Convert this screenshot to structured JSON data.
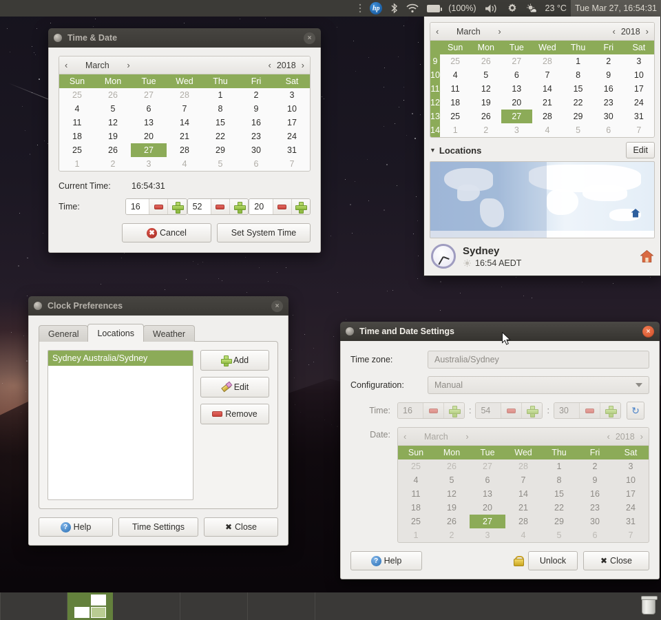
{
  "top_panel": {
    "hp_logo": "hp",
    "icons": [
      "dots-icon",
      "hp-logo-icon",
      "bluetooth-icon",
      "wifi-icon",
      "battery-icon",
      "volume-icon",
      "gear-icon",
      "weather-icon"
    ],
    "bluetooth_glyph": "✶",
    "battery_percent": "(100%)",
    "volume_glyph": "◂))",
    "gear_glyph": "⚙",
    "weather_glyph": "☀",
    "temperature": "23 °C",
    "clock": "Tue Mar 27, 16:54:31"
  },
  "time_date_dialog": {
    "title": "Time & Date",
    "close_glyph": "×",
    "calendar": {
      "prev_month_glyph": "‹",
      "month": "March",
      "next_month_glyph": "›",
      "prev_year_glyph": "‹",
      "year": "2018",
      "next_year_glyph": "›",
      "weekdays": [
        "Sun",
        "Mon",
        "Tue",
        "Wed",
        "Thu",
        "Fri",
        "Sat"
      ],
      "weeks": [
        [
          {
            "d": "25",
            "s": "dim"
          },
          {
            "d": "26",
            "s": "dim"
          },
          {
            "d": "27",
            "s": "dim"
          },
          {
            "d": "28",
            "s": "dim"
          },
          {
            "d": "1",
            "s": ""
          },
          {
            "d": "2",
            "s": ""
          },
          {
            "d": "3",
            "s": ""
          }
        ],
        [
          {
            "d": "4",
            "s": ""
          },
          {
            "d": "5",
            "s": ""
          },
          {
            "d": "6",
            "s": ""
          },
          {
            "d": "7",
            "s": ""
          },
          {
            "d": "8",
            "s": ""
          },
          {
            "d": "9",
            "s": ""
          },
          {
            "d": "10",
            "s": ""
          }
        ],
        [
          {
            "d": "11",
            "s": ""
          },
          {
            "d": "12",
            "s": ""
          },
          {
            "d": "13",
            "s": ""
          },
          {
            "d": "14",
            "s": ""
          },
          {
            "d": "15",
            "s": ""
          },
          {
            "d": "16",
            "s": ""
          },
          {
            "d": "17",
            "s": ""
          }
        ],
        [
          {
            "d": "18",
            "s": ""
          },
          {
            "d": "19",
            "s": ""
          },
          {
            "d": "20",
            "s": ""
          },
          {
            "d": "21",
            "s": ""
          },
          {
            "d": "22",
            "s": ""
          },
          {
            "d": "23",
            "s": ""
          },
          {
            "d": "24",
            "s": ""
          }
        ],
        [
          {
            "d": "25",
            "s": ""
          },
          {
            "d": "26",
            "s": ""
          },
          {
            "d": "27",
            "s": "sel"
          },
          {
            "d": "28",
            "s": ""
          },
          {
            "d": "29",
            "s": ""
          },
          {
            "d": "30",
            "s": ""
          },
          {
            "d": "31",
            "s": ""
          }
        ],
        [
          {
            "d": "1",
            "s": "dim"
          },
          {
            "d": "2",
            "s": "dim"
          },
          {
            "d": "3",
            "s": "dim"
          },
          {
            "d": "4",
            "s": "dim"
          },
          {
            "d": "5",
            "s": "dim"
          },
          {
            "d": "6",
            "s": "dim"
          },
          {
            "d": "7",
            "s": "dim"
          }
        ]
      ]
    },
    "current_time_label": "Current Time:",
    "current_time_value": "16:54:31",
    "time_label": "Time:",
    "hours": "16",
    "minutes": "52",
    "seconds": "20",
    "cancel_label": "Cancel",
    "set_system_time_label": "Set System Time"
  },
  "indicator_panel": {
    "calendar": {
      "prev_month_glyph": "‹",
      "month": "March",
      "next_month_glyph": "›",
      "prev_year_glyph": "‹",
      "year": "2018",
      "next_year_glyph": "›",
      "weekdays": [
        "Sun",
        "Mon",
        "Tue",
        "Wed",
        "Thu",
        "Fri",
        "Sat"
      ],
      "week_numbers": [
        "9",
        "10",
        "11",
        "12",
        "13",
        "14"
      ],
      "weeks": [
        [
          {
            "d": "25",
            "s": "dim"
          },
          {
            "d": "26",
            "s": "dim"
          },
          {
            "d": "27",
            "s": "dim"
          },
          {
            "d": "28",
            "s": "dim"
          },
          {
            "d": "1",
            "s": ""
          },
          {
            "d": "2",
            "s": ""
          },
          {
            "d": "3",
            "s": ""
          }
        ],
        [
          {
            "d": "4",
            "s": ""
          },
          {
            "d": "5",
            "s": ""
          },
          {
            "d": "6",
            "s": ""
          },
          {
            "d": "7",
            "s": ""
          },
          {
            "d": "8",
            "s": ""
          },
          {
            "d": "9",
            "s": ""
          },
          {
            "d": "10",
            "s": ""
          }
        ],
        [
          {
            "d": "11",
            "s": ""
          },
          {
            "d": "12",
            "s": ""
          },
          {
            "d": "13",
            "s": ""
          },
          {
            "d": "14",
            "s": ""
          },
          {
            "d": "15",
            "s": ""
          },
          {
            "d": "16",
            "s": ""
          },
          {
            "d": "17",
            "s": ""
          }
        ],
        [
          {
            "d": "18",
            "s": ""
          },
          {
            "d": "19",
            "s": ""
          },
          {
            "d": "20",
            "s": ""
          },
          {
            "d": "21",
            "s": ""
          },
          {
            "d": "22",
            "s": ""
          },
          {
            "d": "23",
            "s": ""
          },
          {
            "d": "24",
            "s": ""
          }
        ],
        [
          {
            "d": "25",
            "s": ""
          },
          {
            "d": "26",
            "s": ""
          },
          {
            "d": "27",
            "s": "sel"
          },
          {
            "d": "28",
            "s": ""
          },
          {
            "d": "29",
            "s": ""
          },
          {
            "d": "30",
            "s": ""
          },
          {
            "d": "31",
            "s": ""
          }
        ],
        [
          {
            "d": "1",
            "s": "dim"
          },
          {
            "d": "2",
            "s": "dim"
          },
          {
            "d": "3",
            "s": "dim"
          },
          {
            "d": "4",
            "s": "dim"
          },
          {
            "d": "5",
            "s": "dim"
          },
          {
            "d": "6",
            "s": "dim"
          },
          {
            "d": "7",
            "s": "dim"
          }
        ]
      ]
    },
    "locations_disclosure_glyph": "▼",
    "locations_label": "Locations",
    "edit_label": "Edit",
    "location_name": "Sydney",
    "location_time": "16:54 AEDT",
    "location_weather_glyph": "☀"
  },
  "clock_preferences": {
    "title": "Clock Preferences",
    "close_glyph": "×",
    "tabs": [
      {
        "label": "General",
        "selected": false
      },
      {
        "label": "Locations",
        "selected": true
      },
      {
        "label": "Weather",
        "selected": false
      }
    ],
    "location_rows": [
      "Sydney  Australia/Sydney"
    ],
    "add_label": "Add",
    "edit_label": "Edit",
    "remove_label": "Remove",
    "help_label": "Help",
    "time_settings_label": "Time Settings",
    "close_label": "Close",
    "help_glyph": "?",
    "close_x_glyph": "✖"
  },
  "time_and_date_settings": {
    "title": "Time and Date Settings",
    "close_glyph": "×",
    "timezone_label": "Time zone:",
    "timezone_value": "Australia/Sydney",
    "configuration_label": "Configuration:",
    "configuration_value": "Manual",
    "time_label": "Time:",
    "hours": "16",
    "minutes": "54",
    "seconds": "30",
    "time_separator": ":",
    "refresh_glyph": "↻",
    "date_label": "Date:",
    "calendar": {
      "prev_month_glyph": "‹",
      "month": "March",
      "next_month_glyph": "›",
      "prev_year_glyph": "‹",
      "year": "2018",
      "next_year_glyph": "›",
      "weekdays": [
        "Sun",
        "Mon",
        "Tue",
        "Wed",
        "Thu",
        "Fri",
        "Sat"
      ],
      "weeks": [
        [
          {
            "d": "25",
            "s": "dim"
          },
          {
            "d": "26",
            "s": "dim"
          },
          {
            "d": "27",
            "s": "dim"
          },
          {
            "d": "28",
            "s": "dim"
          },
          {
            "d": "1",
            "s": ""
          },
          {
            "d": "2",
            "s": ""
          },
          {
            "d": "3",
            "s": ""
          }
        ],
        [
          {
            "d": "4",
            "s": ""
          },
          {
            "d": "5",
            "s": ""
          },
          {
            "d": "6",
            "s": ""
          },
          {
            "d": "7",
            "s": ""
          },
          {
            "d": "8",
            "s": ""
          },
          {
            "d": "9",
            "s": ""
          },
          {
            "d": "10",
            "s": ""
          }
        ],
        [
          {
            "d": "11",
            "s": ""
          },
          {
            "d": "12",
            "s": ""
          },
          {
            "d": "13",
            "s": ""
          },
          {
            "d": "14",
            "s": ""
          },
          {
            "d": "15",
            "s": ""
          },
          {
            "d": "16",
            "s": ""
          },
          {
            "d": "17",
            "s": ""
          }
        ],
        [
          {
            "d": "18",
            "s": ""
          },
          {
            "d": "19",
            "s": ""
          },
          {
            "d": "20",
            "s": ""
          },
          {
            "d": "21",
            "s": ""
          },
          {
            "d": "22",
            "s": ""
          },
          {
            "d": "23",
            "s": ""
          },
          {
            "d": "24",
            "s": ""
          }
        ],
        [
          {
            "d": "25",
            "s": ""
          },
          {
            "d": "26",
            "s": ""
          },
          {
            "d": "27",
            "s": "sel"
          },
          {
            "d": "28",
            "s": ""
          },
          {
            "d": "29",
            "s": ""
          },
          {
            "d": "30",
            "s": ""
          },
          {
            "d": "31",
            "s": ""
          }
        ],
        [
          {
            "d": "1",
            "s": "dim"
          },
          {
            "d": "2",
            "s": "dim"
          },
          {
            "d": "3",
            "s": "dim"
          },
          {
            "d": "4",
            "s": "dim"
          },
          {
            "d": "5",
            "s": "dim"
          },
          {
            "d": "6",
            "s": "dim"
          },
          {
            "d": "7",
            "s": "dim"
          }
        ]
      ]
    },
    "help_label": "Help",
    "unlock_label": "Unlock",
    "close_label": "Close",
    "help_glyph": "?",
    "close_x_glyph": "✖"
  },
  "colors": {
    "accent_green": "#8cab58",
    "panel_bg": "#3c3b37",
    "window_bg": "#f0efed",
    "titlebar_active": "#35332f",
    "close_red": "#d2502a"
  }
}
